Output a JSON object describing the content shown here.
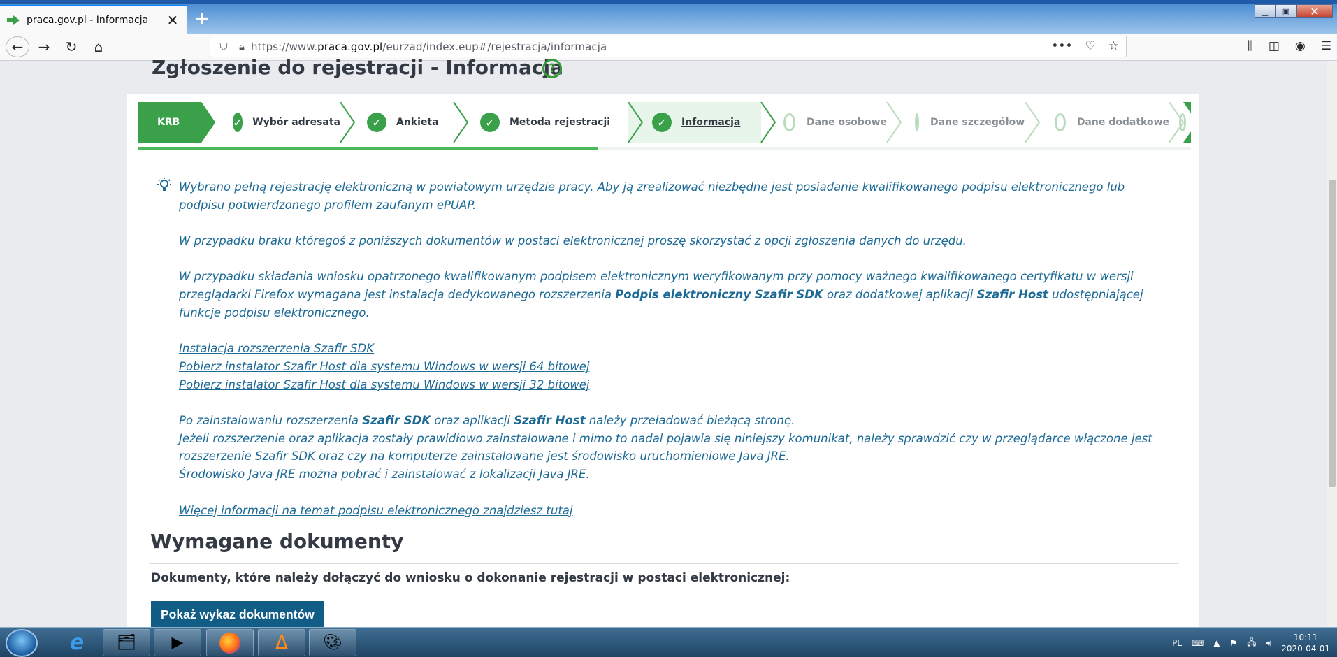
{
  "browser": {
    "tab_title": "praca.gov.pl - Informacja",
    "url_prefix": "https://www.",
    "url_domain": "praca.gov.pl",
    "url_path": "/eurzad/index.eup#/rejestracja/informacja",
    "icons": [
      "back-icon",
      "forward-icon",
      "reload-icon",
      "home-icon",
      "shield-icon",
      "lock-icon",
      "more-icon",
      "pocket-icon",
      "bookmark-star-icon",
      "library-icon",
      "sidebar-icon",
      "account-icon",
      "menu-icon"
    ]
  },
  "page": {
    "heading": "Zgłoszenie do rejestracji - Informacja",
    "help": "?"
  },
  "stepper": {
    "krb": "KRB",
    "steps": [
      {
        "label": "Wybór adresata",
        "state": "done"
      },
      {
        "label": "Ankieta",
        "state": "done"
      },
      {
        "label": "Metoda rejestracji",
        "state": "done"
      },
      {
        "label": "Informacja",
        "state": "current"
      },
      {
        "label": "Dane osobowe",
        "state": "todo"
      },
      {
        "label": "Dane szczegółowe",
        "state": "todo"
      },
      {
        "label": "Dane dodatkowe",
        "state": "todo"
      }
    ],
    "progress_fraction": 0.437,
    "colors": {
      "green": "#3aa14a",
      "light_green": "#e8f5ea",
      "done_text": "#333a43",
      "todo_text": "#8a8f94"
    }
  },
  "info": {
    "p1": "Wybrano pełną rejestrację elektroniczną w powiatowym urzędzie pracy. Aby ją zrealizować niezbędne jest posiadanie kwalifikowanego podpisu elektronicznego lub podpisu potwierdzonego profilem zaufanym ePUAP.",
    "p2": "W przypadku braku któregoś z poniższych dokumentów w postaci elektronicznej proszę skorzystać z opcji zgłoszenia danych do urzędu.",
    "p3_a": "W przypadku składania wniosku opatrzonego kwalifikowanym podpisem elektronicznym weryfikowanym przy pomocy ważnego kwalifikowanego certyfikatu w wersji przeglądarki Firefox wymagana jest instalacja dedykowanego rozszerzenia ",
    "p3_b": "Podpis elektroniczny Szafir SDK",
    "p3_c": " oraz dodatkowej aplikacji ",
    "p3_d": "Szafir Host",
    "p3_e": " udostępniającej funkcje podpisu elektronicznego.",
    "link1": "Instalacja rozszerzenia Szafir SDK",
    "link2": "Pobierz instalator Szafir Host dla systemu Windows w wersji 64 bitowej",
    "link3": "Pobierz instalator Szafir Host dla systemu Windows w wersji 32 bitowej",
    "p4_a": "Po zainstalowaniu rozszerzenia ",
    "p4_b": "Szafir SDK",
    "p4_c": " oraz aplikacji ",
    "p4_d": "Szafir Host",
    "p4_e": " należy przeładować bieżącą stronę.",
    "p5": "Jeżeli rozszerzenie oraz aplikacja zostały prawidłowo zainstalowane i mimo to nadal pojawia się niniejszy komunikat, należy sprawdzić czy w przeglądarce włączone jest rozszerzenie Szafir SDK oraz czy na komputerze zainstalowane jest środowisko uruchomieniowe Java JRE.",
    "p6_a": "Środowisko Java JRE można pobrać i zainstalować z lokalizacji ",
    "p6_link": "Java JRE.",
    "more_link": "Więcej informacji na temat podpisu elektronicznego znajdziesz tutaj"
  },
  "documents": {
    "heading": "Wymagane dokumenty",
    "text": "Dokumenty, które należy dołączyć do wniosku o dokonanie rejestracji w postaci elektronicznej:",
    "button": "Pokaż wykaz dokumentów"
  },
  "taskbar": {
    "lang": "PL",
    "time": "10:11",
    "date": "2020-04-01"
  }
}
